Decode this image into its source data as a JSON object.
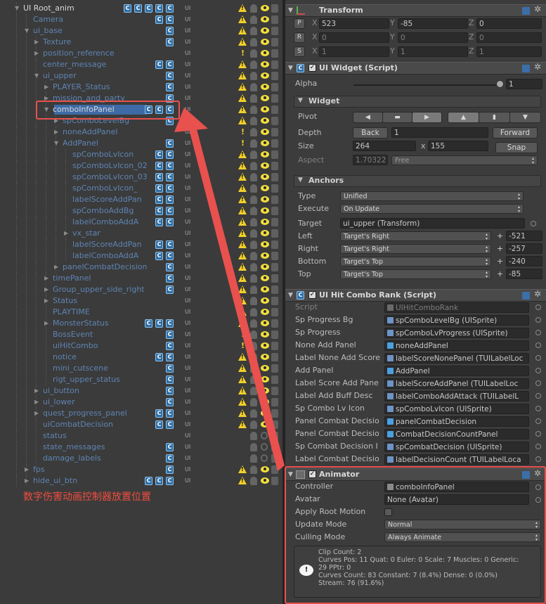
{
  "hierarchy": {
    "rows": [
      {
        "name": "UI Root_anim",
        "white": true
      },
      {
        "name": "Camera"
      },
      {
        "name": "ui_base"
      },
      {
        "name": "Texture"
      },
      {
        "name": "position_reference"
      },
      {
        "name": "center_message"
      },
      {
        "name": "ui_upper"
      },
      {
        "name": "PLAYER_Status"
      },
      {
        "name": "mission_and_party"
      },
      {
        "name": "comboInfoPanel",
        "white": true
      },
      {
        "name": "spComboLevelBg"
      },
      {
        "name": "noneAddPanel"
      },
      {
        "name": "AddPanel"
      },
      {
        "name": "spComboLvIcon"
      },
      {
        "name": "spComboLvIcon_02"
      },
      {
        "name": "spComboLvIcon_03"
      },
      {
        "name": "spComboLvIcon_"
      },
      {
        "name": "labelScoreAddPan"
      },
      {
        "name": "spComboAddBg"
      },
      {
        "name": "labelComboAddA"
      },
      {
        "name": "vx_star"
      },
      {
        "name": "labelScoreAddPan"
      },
      {
        "name": "labelComboAddA"
      },
      {
        "name": "panelCombatDecision"
      },
      {
        "name": "timePanel"
      },
      {
        "name": "Group_upper_side_right"
      },
      {
        "name": "Status"
      },
      {
        "name": "PLAYTIME"
      },
      {
        "name": "MonsterStatus"
      },
      {
        "name": "BossEvent"
      },
      {
        "name": "uiHitCombo"
      },
      {
        "name": "notice"
      },
      {
        "name": "mini_cutscene"
      },
      {
        "name": "rigt_upper_status"
      },
      {
        "name": "ui_button"
      },
      {
        "name": "ui_lower"
      },
      {
        "name": "quest_progress_panel"
      },
      {
        "name": "uiCombatDecision"
      },
      {
        "name": "status"
      },
      {
        "name": "state_messages"
      },
      {
        "name": "damage_labels"
      },
      {
        "name": "fps"
      },
      {
        "name": "hide_ui_btn"
      }
    ],
    "layer_tag": "UI",
    "caption": "数字伤害动画控制器放置位置"
  },
  "inspector": {
    "transform": {
      "title": "Transform",
      "rows": [
        {
          "btn": "P",
          "x": "523",
          "y": "-85",
          "z": "0"
        },
        {
          "btn": "R",
          "x": "0",
          "y": "0",
          "z": "0"
        },
        {
          "btn": "S",
          "x": "1",
          "y": "1",
          "z": "1"
        }
      ],
      "axis_x": "X",
      "axis_y": "Y",
      "axis_z": "Z"
    },
    "widget_script": {
      "title": "UI Widget (Script)",
      "alpha_label": "Alpha",
      "alpha_value": "1",
      "widget_header": "Widget",
      "pivot_label": "Pivot",
      "depth_label": "Depth",
      "depth_back": "Back",
      "depth_value": "1",
      "depth_forward": "Forward",
      "size_label": "Size",
      "size_w": "264",
      "size_x": "x",
      "size_h": "155",
      "snap": "Snap",
      "aspect_label": "Aspect",
      "aspect_value": "1.70322",
      "aspect_mode": "Free",
      "anchors_header": "Anchors",
      "type_label": "Type",
      "type_value": "Unified",
      "execute_label": "Execute",
      "execute_value": "On Update",
      "target_label": "Target",
      "target_value": "ui_upper (Transform)",
      "anchors": [
        {
          "label": "Left",
          "mode": "Target's Right",
          "value": "-521"
        },
        {
          "label": "Right",
          "mode": "Target's Right",
          "value": "-257"
        },
        {
          "label": "Bottom",
          "mode": "Target's Top",
          "value": "-240"
        },
        {
          "label": "Top",
          "mode": "Target's Top",
          "value": "-85"
        }
      ]
    },
    "hit_combo": {
      "title": "UI Hit Combo Rank (Script)",
      "rows": [
        {
          "label": "Script",
          "value": "UIHitComboRank",
          "dim": true
        },
        {
          "label": "Sp Progress Bg",
          "value": "spComboLevelBg (UISprite)"
        },
        {
          "label": "Sp Progress",
          "value": "spComboLvProgress (UISprite)"
        },
        {
          "label": "None Add Panel",
          "value": "noneAddPanel"
        },
        {
          "label": "Label None Add Score",
          "value": "labelScoreNonePanel (TUILabelLoc"
        },
        {
          "label": "Add Panel",
          "value": "AddPanel"
        },
        {
          "label": "Label Score Add Pane",
          "value": "labelScoreAddPanel (TUILabelLoc"
        },
        {
          "label": "Label Add Buff Desc",
          "value": "labelComboAddAttack (TUILabelL"
        },
        {
          "label": "Sp Combo Lv Icon",
          "value": "spComboLvIcon (UISprite)"
        },
        {
          "label": "Panel Combat Decisio",
          "value": "panelCombatDecision"
        },
        {
          "label": "Panel Combat Decisio",
          "value": "CombatDecisionCountPanel"
        },
        {
          "label": "Sp Combat Decision I",
          "value": "spCombatDecision (UISprite)"
        },
        {
          "label": "Label Combat Decisio",
          "value": "labelDecisionCount (TUILabelLoca"
        }
      ]
    },
    "animator": {
      "title": "Animator",
      "controller_label": "Controller",
      "controller_value": "comboInfoPanel",
      "avatar_label": "Avatar",
      "avatar_value": "None (Avatar)",
      "root_motion_label": "Apply Root Motion",
      "update_mode_label": "Update Mode",
      "update_mode_value": "Normal",
      "culling_label": "Culling Mode",
      "culling_value": "Always Animate",
      "info": [
        "Clip Count: 2",
        "Curves Pos: 11 Quat: 0 Euler: 0 Scale: 7 Muscles: 0 Generic:",
        "29 PPtr: 0",
        "Curves Count: 83 Constant: 7 (8.4%) Dense: 0 (0.0%)",
        "Stream: 76 (91.6%)"
      ]
    },
    "colors": {
      "highlight": "#e8514e",
      "selected": "#3e6aa6",
      "link": "#5e84b3"
    }
  }
}
